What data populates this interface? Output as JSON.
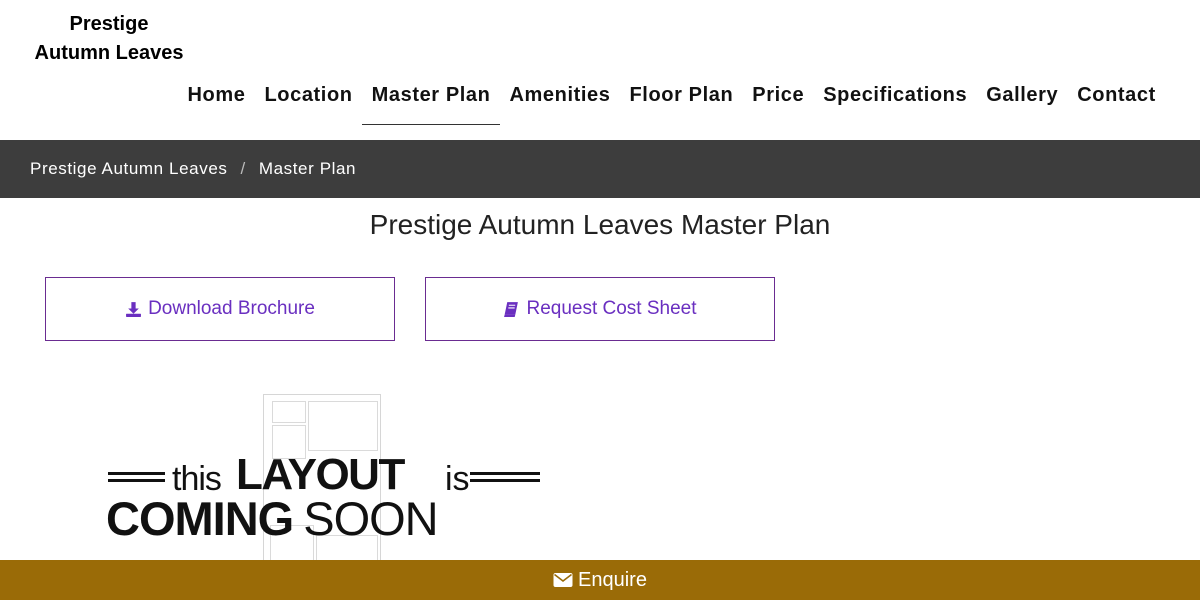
{
  "logo": {
    "line1": "Prestige",
    "line2": "Autumn Leaves"
  },
  "nav": {
    "items": [
      {
        "label": "Home",
        "active": false
      },
      {
        "label": "Location",
        "active": false
      },
      {
        "label": "Master Plan",
        "active": true
      },
      {
        "label": "Amenities",
        "active": false
      },
      {
        "label": "Floor Plan",
        "active": false
      },
      {
        "label": "Price",
        "active": false
      },
      {
        "label": "Specifications",
        "active": false
      },
      {
        "label": "Gallery",
        "active": false
      },
      {
        "label": "Contact",
        "active": false
      }
    ]
  },
  "breadcrumb": {
    "parent": "Prestige Autumn Leaves",
    "separator": "/",
    "current": "Master Plan"
  },
  "page_title": "Prestige Autumn Leaves Master Plan",
  "buttons": {
    "download_label": "Download Brochure",
    "download_icon": "download-icon",
    "cost_label": "Request Cost Sheet",
    "cost_icon": "book-icon"
  },
  "placeholder_image": {
    "word_this": "this",
    "word_layout": "LAYOUT",
    "word_is": "is",
    "word_coming": "COMING",
    "word_soon": "SOON"
  },
  "enquire": {
    "label": "Enquire",
    "icon": "envelope-icon"
  },
  "colors": {
    "breadcrumb_bg": "#3d3d3d",
    "button_border": "#6a2c91",
    "button_text": "#6a2fc0",
    "enquire_bg": "#9a6b07"
  }
}
